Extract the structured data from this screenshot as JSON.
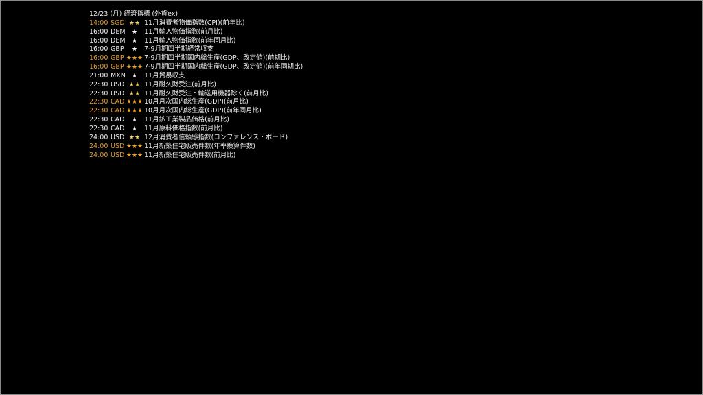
{
  "header": {
    "date_title": "12/23 (月) 経済指標 (外貨ex)"
  },
  "events": [
    {
      "time": "14:00",
      "currency": "SGD",
      "stars": "★★",
      "level": 2,
      "name": "11月消費者物価指数(CPI)(前年比)",
      "highlight": true
    },
    {
      "time": "16:00",
      "currency": "DEM",
      "stars": "★",
      "level": 1,
      "name": "11月輸入物価指数(前月比)",
      "highlight": false
    },
    {
      "time": "16:00",
      "currency": "DEM",
      "stars": "★",
      "level": 1,
      "name": "11月輸入物価指数(前年同月比)",
      "highlight": false
    },
    {
      "time": "16:00",
      "currency": "GBP",
      "stars": "★",
      "level": 1,
      "name": "7-9月期四半期経常収支",
      "highlight": false
    },
    {
      "time": "16:00",
      "currency": "GBP",
      "stars": "★★★",
      "level": 3,
      "name": "7-9月期四半期国内総生産(GDP、改定値)(前期比)",
      "highlight": true
    },
    {
      "time": "16:00",
      "currency": "GBP",
      "stars": "★★★",
      "level": 3,
      "name": "7-9月期四半期国内総生産(GDP、改定値)(前年同期比)",
      "highlight": true
    },
    {
      "time": "21:00",
      "currency": "MXN",
      "stars": "★",
      "level": 1,
      "name": "11月貿易収支",
      "highlight": false
    },
    {
      "time": "22:30",
      "currency": "USD",
      "stars": "★★",
      "level": 2,
      "name": "11月耐久財受注(前月比)",
      "highlight": false
    },
    {
      "time": "22:30",
      "currency": "USD",
      "stars": "★★",
      "level": 2,
      "name": "11月耐久財受注・輸送用機器除く(前月比)",
      "highlight": false
    },
    {
      "time": "22:30",
      "currency": "CAD",
      "stars": "★★★",
      "level": 3,
      "name": "10月月次国内総生産(GDP)(前月比)",
      "highlight": true
    },
    {
      "time": "22:30",
      "currency": "CAD",
      "stars": "★★★",
      "level": 3,
      "name": "10月月次国内総生産(GDP)(前年同月比)",
      "highlight": true
    },
    {
      "time": "22:30",
      "currency": "CAD",
      "stars": "★",
      "level": 1,
      "name": "11月鉱工業製品価格(前月比)",
      "highlight": false
    },
    {
      "time": "22:30",
      "currency": "CAD",
      "stars": "★",
      "level": 1,
      "name": "11月原料価格指数(前月比)",
      "highlight": false
    },
    {
      "time": "24:00",
      "currency": "USD",
      "stars": "★★",
      "level": 2,
      "name": "12月消費者信頼感指数(コンファレンス・ボード)",
      "highlight": false
    },
    {
      "time": "24:00",
      "currency": "USD",
      "stars": "★★★",
      "level": 3,
      "name": "11月新築住宅販売件数(年率換算件数)",
      "highlight": true
    },
    {
      "time": "24:00",
      "currency": "USD",
      "stars": "★★★",
      "level": 3,
      "name": "11月新築住宅販売件数(前月比)",
      "highlight": true
    }
  ],
  "colors": {
    "background": "#000000",
    "text": "#e8e8e8",
    "highlight": "#e09a2c",
    "star_level1": "#ffffff",
    "star_level2": "#f3d86a",
    "star_level3": "#f0a628"
  },
  "icons": {
    "importance": "star-icon"
  }
}
